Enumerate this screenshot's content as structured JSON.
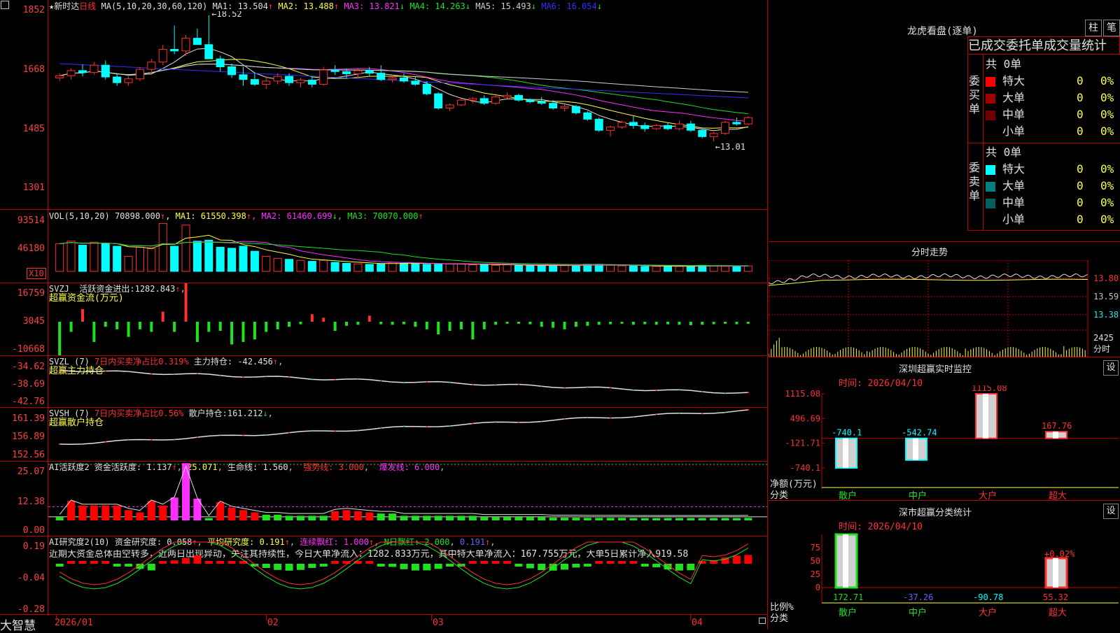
{
  "brand": "大智慧",
  "stock": {
    "name": "新时达",
    "period": "日线"
  },
  "kline": {
    "ma_header": "MA(5,10,20,30,60,120)",
    "ma": [
      {
        "name": "MA1",
        "value": "13.504",
        "arrow": "↑",
        "color": "#e0e0e0"
      },
      {
        "name": "MA2",
        "value": "13.488",
        "arrow": "↑",
        "color": "#ffff40"
      },
      {
        "name": "MA3",
        "value": "13.821",
        "arrow": "↓",
        "color": "#ff30ff"
      },
      {
        "name": "MA4",
        "value": "14.263",
        "arrow": "↓",
        "color": "#20e020"
      },
      {
        "name": "MA5",
        "value": "15.493",
        "arrow": "↓",
        "color": "#d0d0d0"
      },
      {
        "name": "MA6",
        "value": "16.054",
        "arrow": "↓",
        "color": "#3030ff"
      }
    ],
    "yticks": [
      "1852",
      "1668",
      "1485",
      "1301"
    ],
    "high_label": "18.52",
    "low_label": "13.01"
  },
  "candles": [
    [
      16.55,
      16.7,
      16.45,
      16.62
    ],
    [
      16.62,
      16.85,
      16.5,
      16.78
    ],
    [
      16.78,
      16.98,
      16.6,
      16.72
    ],
    [
      16.72,
      17.05,
      16.65,
      16.95
    ],
    [
      16.95,
      17.1,
      16.5,
      16.58
    ],
    [
      16.58,
      16.7,
      16.3,
      16.4
    ],
    [
      16.4,
      16.6,
      16.3,
      16.52
    ],
    [
      16.52,
      16.9,
      16.45,
      16.82
    ],
    [
      16.82,
      17.15,
      16.7,
      17.05
    ],
    [
      17.05,
      17.6,
      16.95,
      17.45
    ],
    [
      17.45,
      18.2,
      17.3,
      17.4
    ],
    [
      17.4,
      17.9,
      17.25,
      17.8
    ],
    [
      17.8,
      18.1,
      17.6,
      17.6
    ],
    [
      17.6,
      18.52,
      17.4,
      17.15
    ],
    [
      17.15,
      17.25,
      16.75,
      16.9
    ],
    [
      16.9,
      17.0,
      16.55,
      16.65
    ],
    [
      16.65,
      16.9,
      16.3,
      16.5
    ],
    [
      16.5,
      16.7,
      16.3,
      16.35
    ],
    [
      16.35,
      16.6,
      16.2,
      16.45
    ],
    [
      16.45,
      16.7,
      16.35,
      16.6
    ],
    [
      16.6,
      16.7,
      16.3,
      16.4
    ],
    [
      16.4,
      16.55,
      16.25,
      16.48
    ],
    [
      16.48,
      16.6,
      16.25,
      16.35
    ],
    [
      16.35,
      16.9,
      16.3,
      16.8
    ],
    [
      16.8,
      16.95,
      16.65,
      16.75
    ],
    [
      16.75,
      16.85,
      16.55,
      16.68
    ],
    [
      16.68,
      16.85,
      16.55,
      16.78
    ],
    [
      16.78,
      16.9,
      16.6,
      16.7
    ],
    [
      16.7,
      16.95,
      16.45,
      16.5
    ],
    [
      16.5,
      16.65,
      16.4,
      16.55
    ],
    [
      16.55,
      16.7,
      16.4,
      16.45
    ],
    [
      16.45,
      16.6,
      16.3,
      16.35
    ],
    [
      16.35,
      16.45,
      16.0,
      16.05
    ],
    [
      16.05,
      16.1,
      15.55,
      15.6
    ],
    [
      15.6,
      15.75,
      15.5,
      15.7
    ],
    [
      15.7,
      15.9,
      15.65,
      15.85
    ],
    [
      15.85,
      15.95,
      15.75,
      15.9
    ],
    [
      15.9,
      16.0,
      15.7,
      15.75
    ],
    [
      15.75,
      16.05,
      15.7,
      15.95
    ],
    [
      15.95,
      16.1,
      15.9,
      16.0
    ],
    [
      16.0,
      16.05,
      15.8,
      15.85
    ],
    [
      15.85,
      15.9,
      15.75,
      15.8
    ],
    [
      15.8,
      15.95,
      15.7,
      15.75
    ],
    [
      15.75,
      15.85,
      15.55,
      15.6
    ],
    [
      15.6,
      15.7,
      15.5,
      15.65
    ],
    [
      15.65,
      15.7,
      15.4,
      15.45
    ],
    [
      15.45,
      15.5,
      15.2,
      15.25
    ],
    [
      15.25,
      15.3,
      14.85,
      14.9
    ],
    [
      14.9,
      15.05,
      14.7,
      15.0
    ],
    [
      15.0,
      15.2,
      14.95,
      15.15
    ],
    [
      15.15,
      15.35,
      14.95,
      15.05
    ],
    [
      15.05,
      15.15,
      14.85,
      14.95
    ],
    [
      14.95,
      15.1,
      14.9,
      15.05
    ],
    [
      15.05,
      15.15,
      14.9,
      14.95
    ],
    [
      14.95,
      15.2,
      14.9,
      15.1
    ],
    [
      15.1,
      15.2,
      14.85,
      14.9
    ],
    [
      14.9,
      14.95,
      14.65,
      14.7
    ],
    [
      14.7,
      14.85,
      14.55,
      14.8
    ],
    [
      14.8,
      15.2,
      14.75,
      15.15
    ],
    [
      15.15,
      15.3,
      15.05,
      15.1
    ],
    [
      15.1,
      15.35,
      15.05,
      15.3
    ]
  ],
  "volume": {
    "header": "VOL(5,10,20)",
    "value": "70898.000",
    "arrow": "↑",
    "ma": [
      {
        "name": "MA1",
        "value": "61550.398",
        "arrow": "↑",
        "color": "#ffff40"
      },
      {
        "name": "MA2",
        "value": "61460.699",
        "arrow": "↓",
        "color": "#ff30ff"
      },
      {
        "name": "MA3",
        "value": "70070.000",
        "arrow": "↑",
        "color": "#20e020"
      }
    ],
    "yticks": [
      "93514",
      "46180"
    ],
    "unit": "X10",
    "bars": [
      55,
      60,
      52,
      58,
      55,
      50,
      30,
      48,
      45,
      95,
      50,
      92,
      60,
      62,
      48,
      46,
      50,
      40,
      30,
      26,
      24,
      22,
      20,
      22,
      18,
      16,
      15,
      14,
      15,
      18,
      16,
      16,
      14,
      14,
      15,
      15,
      13,
      14,
      12,
      13,
      12,
      11,
      12,
      11,
      12,
      12,
      14,
      14,
      12,
      11,
      11,
      10,
      10,
      10,
      10,
      10,
      12,
      11,
      10,
      11,
      11
    ]
  },
  "svzj": {
    "header": "SVZJ",
    "label": "活跃资金进出:",
    "value": "1282.843",
    "arrow": "↑",
    "subtitle": "超赢资金流(万元)",
    "yticks": [
      "16759",
      "3045",
      "-10668"
    ],
    "bars": [
      -9000,
      -2000,
      2500,
      -4000,
      -1000,
      -1500,
      -3000,
      -1500,
      -2000,
      2000,
      -2000,
      9000,
      -4000,
      -2000,
      -1800,
      -4500,
      -4000,
      -3500,
      -2000,
      -1500,
      -1000,
      -500,
      1500,
      800,
      -1800,
      -800,
      -600,
      1200,
      -500,
      -600,
      -500,
      -1000,
      -1500,
      -2500,
      -1800,
      -1500,
      -3500,
      -1500,
      -600,
      -400,
      -400,
      -500,
      -1000,
      -1200,
      -1500,
      -1000,
      -800,
      -600,
      -500,
      -400,
      -600,
      -500,
      -600,
      -500,
      -600,
      -700,
      -600,
      -500,
      -400,
      -500,
      -400
    ]
  },
  "svzl": {
    "header": "SVZL (7)",
    "label1": "7日内买卖净占比",
    "pct": "0.319%",
    "label2": "主力持仓:",
    "value": "-42.456",
    "arrow": "↑",
    "subtitle": "超赢主力持仓",
    "yticks": [
      "-34.62",
      "-38.69",
      "-42.76"
    ]
  },
  "svsh": {
    "header": "SVSH (7)",
    "label1": "7日内买卖净占比",
    "pct": "0.56%",
    "label2": "散户持仓:",
    "value": "161.212",
    "arrow": "↓",
    "subtitle": "超赢散户持仓",
    "yticks": [
      "161.39",
      "156.89",
      "152.56"
    ]
  },
  "ai_active": {
    "header": "AI活跃度2",
    "label": "资金活跃度:",
    "value": "1.137",
    "v2": "25.071",
    "life_label": "生命线:",
    "life": "1.560",
    "strong_label": "强势线:",
    "strong": "3.000",
    "burst_label": "爆发线:",
    "burst": "6.000",
    "yticks": [
      "25.07",
      "12.38",
      "0.00"
    ],
    "bars": [
      1.5,
      8.5,
      6.5,
      6.5,
      6.5,
      6.5,
      4.5,
      3.5,
      8.5,
      6.5,
      10,
      25,
      9.5,
      1.0,
      8,
      5.5,
      4.5,
      3.5,
      2.5,
      2.5,
      2,
      2,
      2,
      2,
      4,
      4.5,
      4,
      3.5,
      3,
      3,
      2,
      2,
      2,
      2,
      2,
      2,
      2,
      1.5,
      1.5,
      1.5,
      1.5,
      1.5,
      1.5,
      1.2,
      1.2,
      1.2,
      1.1,
      1.1,
      1.1,
      1.1,
      1,
      1,
      1,
      1,
      1,
      1,
      1,
      1,
      1,
      1,
      1.1
    ]
  },
  "ai_research": {
    "header": "AI研究度2(10)",
    "label": "资金研究度:",
    "value": "0.058",
    "avg_label": "平均研究度:",
    "avg": "0.191",
    "cont_label": "连续飘红:",
    "cont": "1.000",
    "n_label": "N日飘红:",
    "n": "2.000",
    "v5": "0.191",
    "yticks": [
      "0.19",
      "-0.04",
      "-0.28"
    ],
    "comment": "近期大资金总体由空转多，近两日出现异动，关注其持续性，今日大单净流入：1282.833万元，其中特大单净流入：167.755万元，大单5日累计净入919.58"
  },
  "xaxis": [
    "2026/01",
    "02",
    "03",
    "04"
  ],
  "lhb": {
    "title": "龙虎看盘(逐单)",
    "btn1": "柱",
    "btn2": "笔",
    "subtitle": "已成交委托单成交量统计",
    "buy": {
      "side": "委买单",
      "count": "共 0单",
      "rows": [
        {
          "name": "特大",
          "n": "0",
          "p": "0%",
          "color": "#ff0000"
        },
        {
          "name": "大单",
          "n": "0",
          "p": "0%",
          "color": "#a00000"
        },
        {
          "name": "中单",
          "n": "0",
          "p": "0%",
          "color": "#700000"
        },
        {
          "name": "小单",
          "n": "0",
          "p": "0%",
          "color": "#000000"
        }
      ]
    },
    "sell": {
      "side": "委卖单",
      "count": "共 0单",
      "rows": [
        {
          "name": "特大",
          "n": "0",
          "p": "0%",
          "color": "#00ffff"
        },
        {
          "name": "大单",
          "n": "0",
          "p": "0%",
          "color": "#008080"
        },
        {
          "name": "中单",
          "n": "0",
          "p": "0%",
          "color": "#006060"
        },
        {
          "name": "小单",
          "n": "0",
          "p": "0%",
          "color": "#000000"
        }
      ]
    }
  },
  "intraday": {
    "title": "分时走势",
    "yticks": [
      "13.80",
      "13.59",
      "13.38"
    ],
    "vol": "2425",
    "unit": "分时"
  },
  "monitor": {
    "title": "深圳超赢实时监控",
    "btn": "设",
    "time": "时间: 2026/04/10",
    "yticks": [
      "1115.08",
      "496.69",
      "-121.71",
      "-740.1"
    ],
    "net_label": "净额(万元)",
    "cat_label": "分类",
    "cats": [
      "散户",
      "中户",
      "大户",
      "超大"
    ],
    "values": [
      -740.1,
      -542.74,
      1115.08,
      167.76
    ],
    "value_labels": [
      "-740.1",
      "-542.74",
      "1115.08",
      "167.76"
    ]
  },
  "classify": {
    "title": "深市超赢分类统计",
    "btn": "设",
    "time": "时间: 2026/04/10",
    "yticks": [
      "75",
      "50",
      "25",
      "0"
    ],
    "ratio_label": "比例%",
    "cat_label": "分类",
    "cats": [
      "散户",
      "中户",
      "大户",
      "超大"
    ],
    "values": [
      172.71,
      -37.26,
      -90.78,
      55.32
    ],
    "value_labels": [
      "172.71",
      "-37.26",
      "-90.78",
      "55.32"
    ],
    "note": "+0.02%"
  }
}
